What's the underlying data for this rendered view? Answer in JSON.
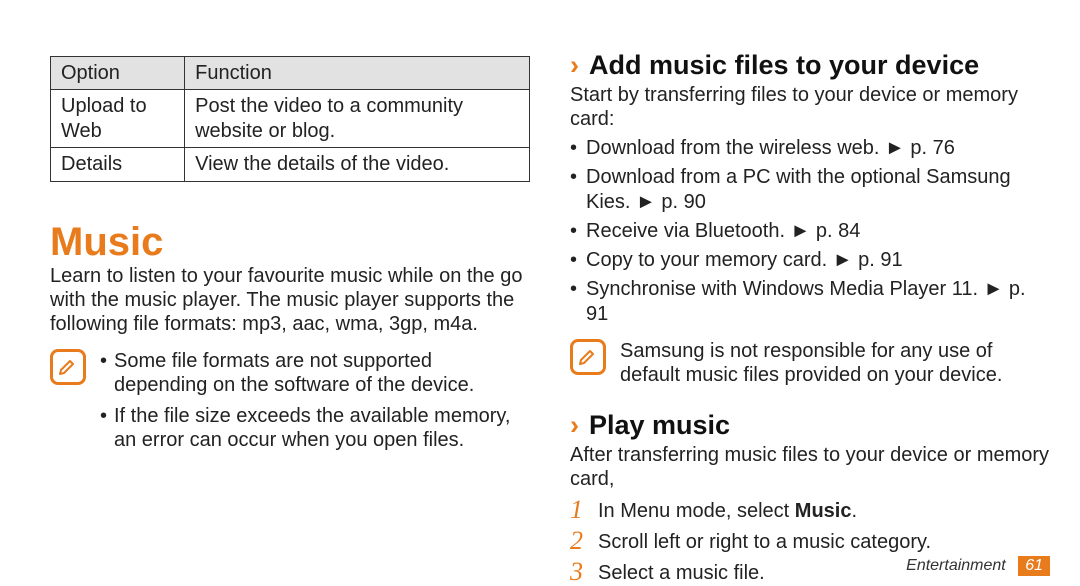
{
  "table": {
    "headers": {
      "option": "Option",
      "function": "Function"
    },
    "rows": [
      {
        "option": "Upload to Web",
        "function": "Post the video to a community website or blog."
      },
      {
        "option": "Details",
        "function": "View the details of the video."
      }
    ]
  },
  "music": {
    "heading": "Music",
    "intro": "Learn to listen to your favourite music while on the go with the music player. The music player supports the following file formats: mp3, aac, wma, 3gp, m4a.",
    "note": [
      "Some file formats are not supported depending on the software of the device.",
      "If the file size exceeds the available memory, an error can occur when you open files."
    ]
  },
  "add_music": {
    "heading": "Add music files to your device",
    "intro": "Start by transferring files to your device or memory card:",
    "bullets": [
      "Download from the wireless web. ► p. 76",
      "Download from a PC with the optional Samsung Kies. ► p. 90",
      "Receive via Bluetooth. ► p. 84",
      "Copy to your memory card. ► p. 91",
      "Synchronise with Windows Media Player 11. ► p. 91"
    ],
    "note": "Samsung is not responsible for any use of default music files provided on your device."
  },
  "play_music": {
    "heading": "Play music",
    "intro": "After transferring music files to your device or memory card,",
    "steps": [
      {
        "n": "1",
        "prefix": "In Menu mode, select ",
        "bold": "Music",
        "suffix": "."
      },
      {
        "n": "2",
        "prefix": "Scroll left or right to a music category.",
        "bold": "",
        "suffix": ""
      },
      {
        "n": "3",
        "prefix": "Select a music file.",
        "bold": "",
        "suffix": ""
      }
    ]
  },
  "footer": {
    "section": "Entertainment",
    "page": "61"
  }
}
